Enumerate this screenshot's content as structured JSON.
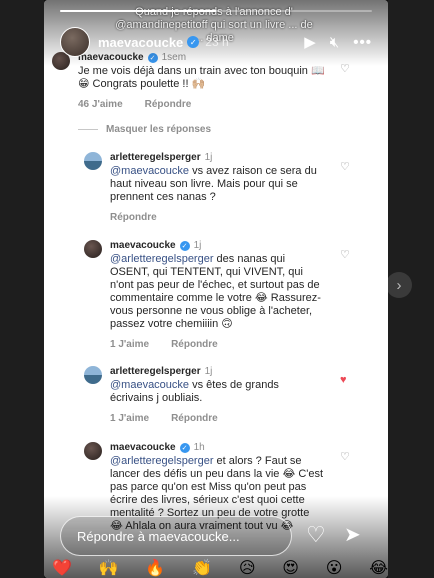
{
  "story": {
    "username": "maevacoucke",
    "time": "23 h",
    "overlay_text": "Quand je réponds à l'annonce d' @amandinepetitoff qui sort un livre ... de ... dame",
    "progress": 0.5,
    "icons": [
      "play-icon",
      "mute-icon",
      "more-icon"
    ]
  },
  "comments": [
    {
      "user": "maevacoucke",
      "verified": true,
      "age": "1sem",
      "text": "Je me vois déjà dans un train avec ton bouquin 📖😁 Congrats poulette !! 🙌🏼",
      "likes": "46 J'aime",
      "reply": "Répondre",
      "liked": false
    },
    {
      "user": "arletteregelsperger",
      "verified": false,
      "age": "1j",
      "mention": "@maevacoucke",
      "text": " vs avez raison ce sera du haut niveau son livre. Mais pour qui se prennent ces nanas ?",
      "likes": "",
      "reply": "Répondre",
      "liked": false
    },
    {
      "user": "maevacoucke",
      "verified": true,
      "age": "1j",
      "mention": "@arletteregelsperger",
      "text": " des nanas qui OSENT, qui TENTENT, qui VIVENT, qui n'ont pas peur de l'échec, et surtout pas de commentaire comme le votre 😂 Rassurez-vous personne ne vous oblige à l'acheter, passez votre chemiiiin 🙃",
      "likes": "1 J'aime",
      "reply": "Répondre",
      "liked": false
    },
    {
      "user": "arletteregelsperger",
      "verified": false,
      "age": "1j",
      "mention": "@maevacoucke",
      "text": " vs êtes de grands écrivains j oubliais.",
      "likes": "1 J'aime",
      "reply": "Répondre",
      "liked": true
    },
    {
      "user": "maevacoucke",
      "verified": true,
      "age": "1h",
      "mention": "@arletteregelsperger",
      "text": " et alors ? Faut se lancer des défis un peu dans la vie 😂 C'est pas parce qu'on est Miss qu'on peut pas écrire des livres, sérieux c'est quoi cette mentalité ? Sortez un peu de votre grotte 😂 Ahlala on aura vraiment tout vu 😂",
      "likes": "",
      "reply": "Répondre",
      "liked": false
    }
  ],
  "hide_replies": "Masquer les réponses",
  "reply_placeholder": "Répondre à maevacoucke...",
  "emoji_reactions": [
    "❤️",
    "🙌",
    "🔥",
    "👏",
    "😥",
    "😍",
    "😮",
    "😂"
  ],
  "colors": {
    "verified": "#3897f0",
    "liked_heart": "#ed4956"
  }
}
